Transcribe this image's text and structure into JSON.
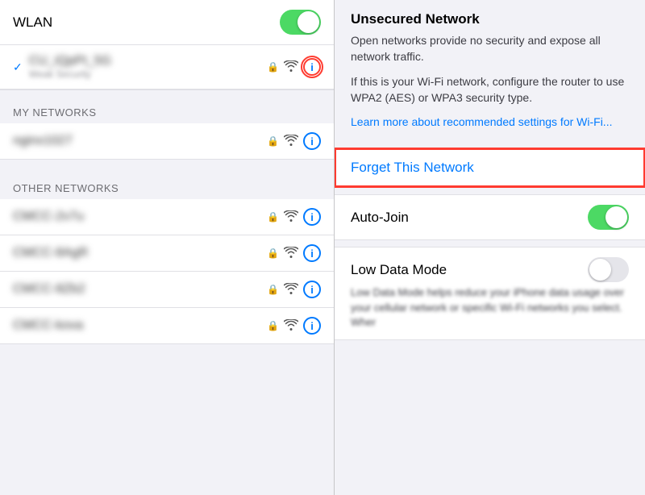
{
  "left": {
    "wlan_label": "WLAN",
    "current_network": {
      "name": "CU_iQpPt_5G",
      "sub": "Weak Security",
      "blurred": true
    },
    "my_networks_header": "MY NETWORKS",
    "my_networks": [
      {
        "name": "nginx1027",
        "blurred": true
      }
    ],
    "other_networks_header": "OTHER NETWORKS",
    "other_networks": [
      {
        "name": "CMCC-2v7u",
        "blurred": true
      },
      {
        "name": "CMCC-8AgR",
        "blurred": true
      },
      {
        "name": "CMCC-8Zb2",
        "blurred": true
      },
      {
        "name": "CMCC-kova",
        "blurred": true
      }
    ]
  },
  "right": {
    "title": "Unsecured Network",
    "description1": "Open networks provide no security and expose all network traffic.",
    "description2": "If this is your Wi-Fi network, configure the router to use WPA2 (AES) or WPA3 security type.",
    "link": "Learn more about recommended settings for Wi-Fi...",
    "forget_label": "Forget This Network",
    "auto_join_label": "Auto-Join",
    "low_data_label": "Low Data Mode",
    "low_data_desc": "Low Data Mode helps reduce your iPhone data usage over your cellular network or specific Wi-Fi networks you select. Wher"
  }
}
